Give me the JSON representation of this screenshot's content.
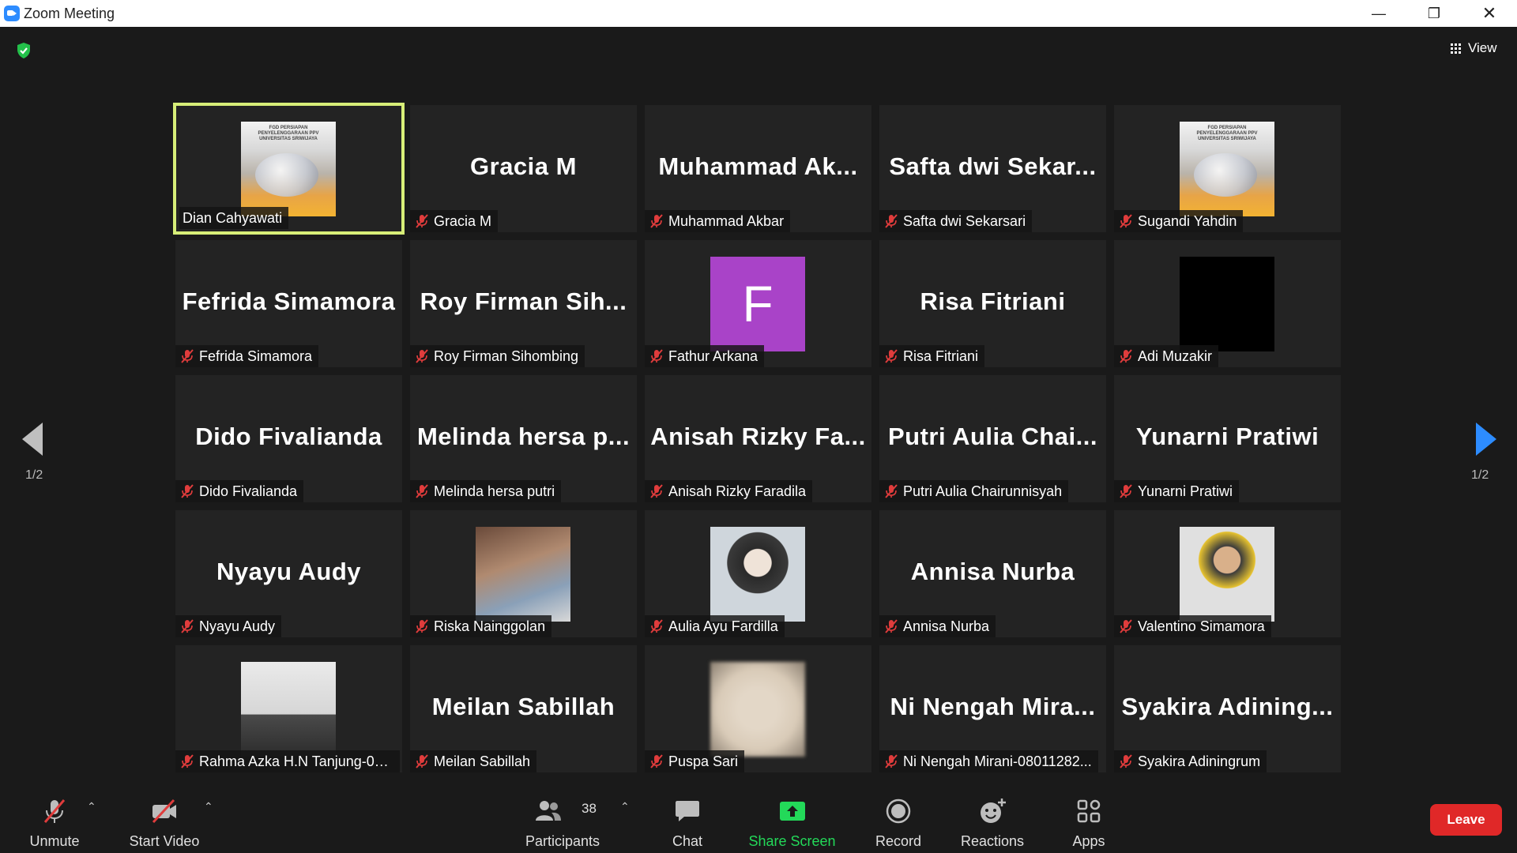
{
  "window": {
    "title": "Zoom Meeting"
  },
  "view_button": {
    "label": "View"
  },
  "pagination": {
    "left": "1/2",
    "right": "1/2"
  },
  "participants_grid": [
    {
      "name": "Dian Cahyawati",
      "big": "",
      "video": "slide",
      "active": true,
      "muted": false,
      "slide_text": "FGD PERSIAPAN PENYELENGGARAAN PPV UNIVERSITAS SRIWIJAYA"
    },
    {
      "name": "Gracia M",
      "big": "Gracia M",
      "video": "none",
      "muted": true
    },
    {
      "name": "Muhammad Akbar",
      "big": "Muhammad Ak...",
      "video": "none",
      "muted": true
    },
    {
      "name": "Safta dwi Sekarsari",
      "big": "Safta dwi Sekar...",
      "video": "none",
      "muted": true
    },
    {
      "name": "Sugandi Yahdin",
      "big": "",
      "video": "slide",
      "muted": true,
      "slide_text": "FGD PERSIAPAN PENYELENGGARAAN PPV UNIVERSITAS SRIWIJAYA"
    },
    {
      "name": "Fefrida Simamora",
      "big": "Fefrida Simamora",
      "video": "none",
      "muted": true
    },
    {
      "name": "Roy Firman Sihombing",
      "big": "Roy Firman Sih...",
      "video": "none",
      "muted": true
    },
    {
      "name": "Fathur Arkana",
      "big": "",
      "video": "letter",
      "letter": "F",
      "muted": true
    },
    {
      "name": "Risa Fitriani",
      "big": "Risa Fitriani",
      "video": "none",
      "muted": true
    },
    {
      "name": "Adi Muzakir",
      "big": "",
      "video": "black",
      "muted": true
    },
    {
      "name": "Dido Fivalianda",
      "big": "Dido Fivalianda",
      "video": "none",
      "muted": true
    },
    {
      "name": "Melinda hersa putri",
      "big": "Melinda hersa p...",
      "video": "none",
      "muted": true
    },
    {
      "name": "Anisah Rizky Faradila",
      "big": "Anisah Rizky Fa...",
      "video": "none",
      "muted": true
    },
    {
      "name": "Putri Aulia Chairunnisyah",
      "big": "Putri Aulia Chai...",
      "video": "none",
      "muted": true
    },
    {
      "name": "Yunarni Pratiwi",
      "big": "Yunarni Pratiwi",
      "video": "none",
      "muted": true
    },
    {
      "name": "Nyayu Audy",
      "big": "Nyayu Audy",
      "video": "none",
      "muted": true
    },
    {
      "name": "Riska Nainggolan",
      "big": "",
      "video": "person1",
      "muted": true
    },
    {
      "name": "Aulia Ayu Fardilla",
      "big": "",
      "video": "person2",
      "muted": true
    },
    {
      "name": "Annisa Nurba",
      "big": "Annisa Nurba",
      "video": "none",
      "muted": true
    },
    {
      "name": "Valentino Simamora",
      "big": "",
      "video": "person3",
      "muted": true
    },
    {
      "name": "Rahma Azka H.N Tanjung-08...",
      "big": "",
      "video": "room",
      "muted": true
    },
    {
      "name": "Meilan Sabillah",
      "big": "Meilan Sabillah",
      "video": "none",
      "muted": true
    },
    {
      "name": "Puspa Sari",
      "big": "",
      "video": "blurred",
      "muted": true
    },
    {
      "name": "Ni Nengah Mirani-08011282...",
      "big": "Ni Nengah Mira...",
      "video": "none",
      "muted": true
    },
    {
      "name": "Syakira Adiningrum",
      "big": "Syakira Adining...",
      "video": "none",
      "muted": true
    }
  ],
  "toolbar": {
    "unmute": "Unmute",
    "start_video": "Start Video",
    "participants": "Participants",
    "participants_count": "38",
    "chat": "Chat",
    "share_screen": "Share Screen",
    "record": "Record",
    "reactions": "Reactions",
    "apps": "Apps",
    "leave": "Leave"
  },
  "colors": {
    "accent": "#2d8cff",
    "share": "#23d959",
    "leave": "#e02828",
    "active_speaker": "#d7ee78",
    "muted_icon": "#e03c3c"
  }
}
